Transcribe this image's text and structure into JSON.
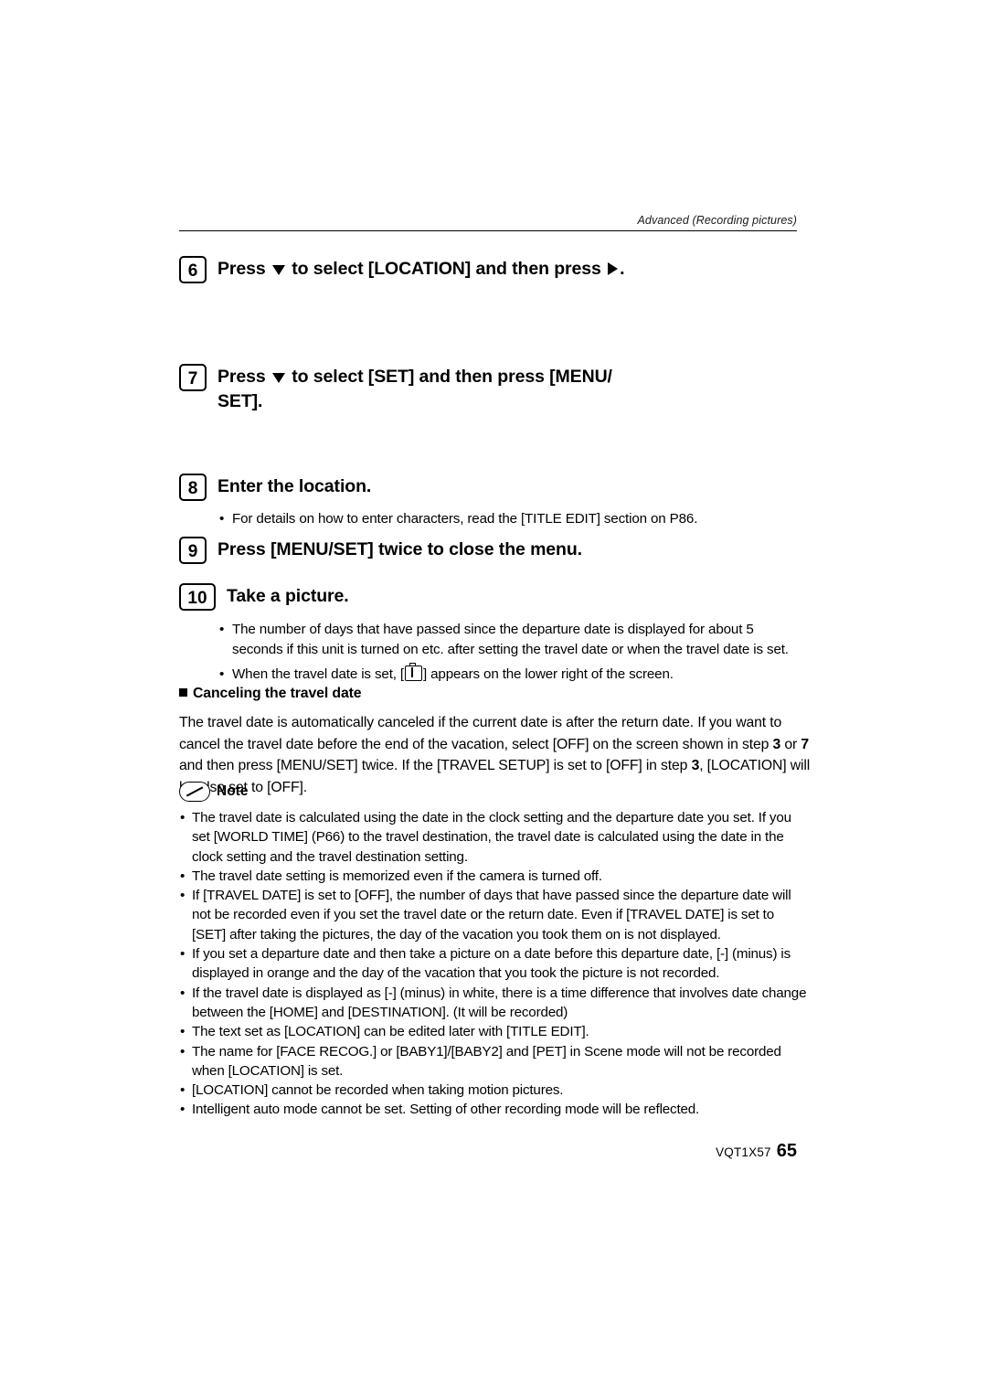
{
  "header": {
    "section": "Advanced (Recording pictures)"
  },
  "steps": [
    {
      "num": "6",
      "title_pre": "Press ",
      "title_mid": " to select [LOCATION] and then press ",
      "title_post": "."
    },
    {
      "num": "7",
      "title_pre": "Press ",
      "title_mid": " to select [SET] and then press [MENU/",
      "title_post": "SET]."
    },
    {
      "num": "8",
      "title": "Enter the location.",
      "bullet": "For details on how to enter characters, read the [TITLE EDIT] section on P86."
    },
    {
      "num": "9",
      "title": "Press [MENU/SET] twice to close the menu."
    },
    {
      "num": "10",
      "title": "Take a picture.",
      "bullets": [
        "The number of days that have passed since the departure date is displayed for about 5 seconds if this unit is turned on etc. after setting the travel date or when the travel date is set.",
        "When the travel date is set, [ ] appears on the lower right of the screen."
      ]
    }
  ],
  "canceling": {
    "heading": "Canceling the travel date",
    "paragraph_1": "The travel date is automatically canceled if the current date is after the return date. If you",
    "paragraph_2": "want to cancel the travel date before the end of the vacation, select [OFF] on the screen",
    "paragraph_3_a": "shown in step ",
    "paragraph_3_b": "3",
    "paragraph_3_c": " or ",
    "paragraph_3_d": "7",
    "paragraph_3_e": " and then press [MENU/SET] twice. If the [TRAVEL SETUP] is set to",
    "paragraph_4_a": "[OFF] in step ",
    "paragraph_4_b": "3",
    "paragraph_4_c": ", [LOCATION] will be also set to [OFF]."
  },
  "note": {
    "label": "Note",
    "items": [
      "The travel date is calculated using the date in the clock setting and the departure date you set. If you set [WORLD TIME] (P66) to the travel destination, the travel date is calculated using the date in the clock setting and the travel destination setting.",
      "The travel date setting is memorized even if the camera is turned off.",
      "If [TRAVEL DATE] is set to [OFF], the number of days that have passed since the departure date will not be recorded even if you set the travel date or the return date. Even if [TRAVEL DATE] is set to [SET] after taking the pictures, the day of the vacation you took them on is not displayed.",
      "If you set a departure date and then take a picture on a date before this departure date, [-] (minus) is displayed in orange and the day of the vacation that you took the picture is not recorded.",
      "If the travel date is displayed as [-] (minus) in white, there is a time difference that involves date change between the [HOME] and [DESTINATION]. (It will be recorded)",
      "The text set as [LOCATION] can be edited later with [TITLE EDIT].",
      "The name for [FACE RECOG.] or [BABY1]/[BABY2] and [PET] in Scene mode  will not be recorded when [LOCATION] is set.",
      "[LOCATION] cannot be recorded when taking motion pictures.",
      "Intelligent auto mode cannot be set. Setting of other recording mode will be reflected."
    ]
  },
  "footer": {
    "code": "VQT1X57",
    "page": "65"
  }
}
